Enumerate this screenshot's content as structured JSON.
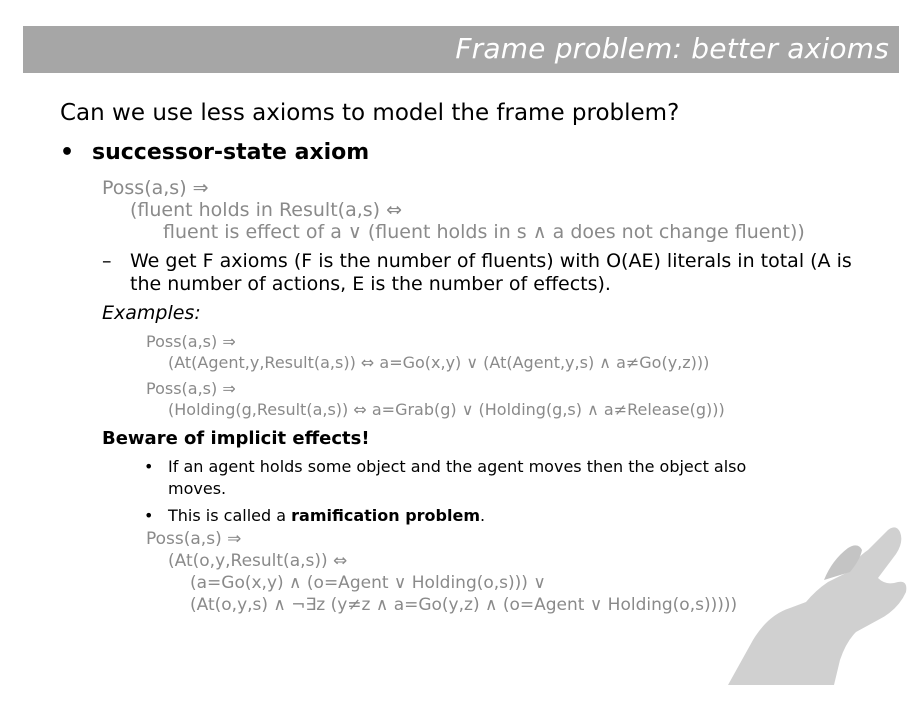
{
  "title": "Frame problem: better axioms",
  "question": "Can we use less axioms to model the frame problem?",
  "bullet_glyph": "•",
  "main_bullet": "successor-state axiom",
  "ssa": {
    "line1": "Poss(a,s) ⇒",
    "line2": "(fluent holds in Result(a,s) ⇔",
    "line3": "fluent is effect of a ∨ (fluent holds in s ∧ a does not change fluent))"
  },
  "dash_glyph": "–",
  "dash_item": {
    "line1": "We get F axioms (F is the number of fluents) with O(AE) literals in total (A is",
    "line2": "the number of actions, E is the number of effects)."
  },
  "examples": {
    "label": "Examples:",
    "ex1_line1": "Poss(a,s) ⇒",
    "ex1_line2": "(At(Agent,y,Result(a,s)) ⇔ a=Go(x,y) ∨ (At(Agent,y,s) ∧ a≠Go(y,z)))",
    "ex2_line1": "Poss(a,s) ⇒",
    "ex2_line2": "(Holding(g,Result(a,s)) ⇔ a=Grab(g) ∨ (Holding(g,s) ∧ a≠Release(g)))"
  },
  "beware": {
    "heading": "Beware of implicit effects!",
    "item1_line1": "If an agent holds some object and the agent moves then the object also",
    "item1_line2": "moves.",
    "item2_prefix": "This is called a ",
    "item2_bold": "ramification problem",
    "item2_suffix": "."
  },
  "ramification": {
    "line1": "Poss(a,s) ⇒",
    "line2": "(At(o,y,Result(a,s)) ⇔",
    "line3": "(a=Go(x,y) ∧ (o=Agent ∨ Holding(o,s))) ∨",
    "line4": "(At(o,y,s) ∧ ¬∃z (y≠z ∧ a=Go(y,z) ∧ (o=Agent ∨ Holding(o,s)))))"
  },
  "decoration": {
    "hand_icon": "hand-frame-icon",
    "hand_color": "#d0d0d0"
  }
}
